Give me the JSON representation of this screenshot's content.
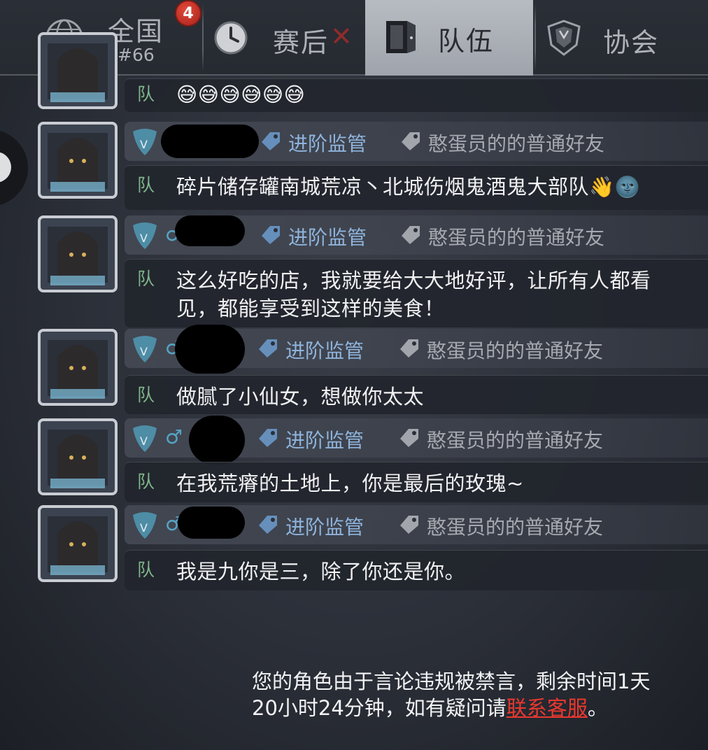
{
  "tabs": {
    "national": {
      "label": "全国",
      "sub": "#66",
      "badge": "4"
    },
    "postmatch": {
      "label": "赛后",
      "mark": "✕"
    },
    "team": {
      "label": "队伍"
    },
    "guild": {
      "label": "协会"
    }
  },
  "first_message": {
    "channel": "队",
    "text": "😅😅😅😅😅😅"
  },
  "messages": [
    {
      "channel": "队",
      "gender": "",
      "tag_rank": "进阶监管",
      "tag_friend": "憨蛋员的的普通好友",
      "text": "碎片储存罐南城荒凉丶北城伤烟鬼酒鬼大部队👋🌚"
    },
    {
      "channel": "队",
      "gender": "♂",
      "tag_rank": "进阶监管",
      "tag_friend": "憨蛋员的的普通好友",
      "text": "这么好吃的店，我就要给大大地好评，让所有人都看见，都能享受到这样的美食！"
    },
    {
      "channel": "队",
      "gender": "♂",
      "tag_rank": "进阶监管",
      "tag_friend": "憨蛋员的的普通好友",
      "text": "做腻了小仙女，想做你太太"
    },
    {
      "channel": "队",
      "gender": "♂",
      "tag_rank": "进阶监管",
      "tag_friend": "憨蛋员的的普通好友",
      "text": "在我荒瘠的土地上，你是最后的玫瑰~"
    },
    {
      "channel": "队",
      "gender": "♂",
      "tag_rank": "进阶监管",
      "tag_friend": "憨蛋员的的普通好友",
      "text": "我是九你是三，除了你还是你。"
    }
  ],
  "notice": {
    "text": "您的角色由于言论违规被禁言，剩余时间1天20小时24分钟，如有疑问请",
    "link": "联系客服",
    "end": "。"
  },
  "colors": {
    "badge": "#c8302a",
    "channel_tag": "#7fb58a",
    "rank_tag": "#8fb4dc",
    "link": "#e8382f",
    "active_tab": "#aeb2b9"
  }
}
